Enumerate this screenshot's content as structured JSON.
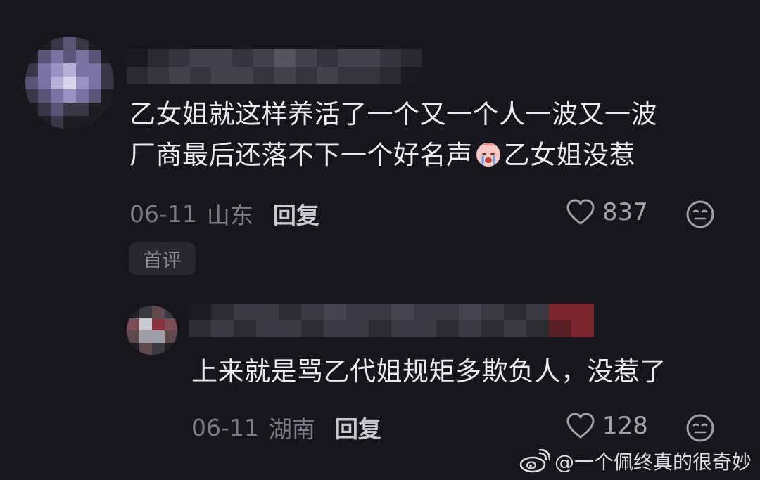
{
  "main_comment": {
    "text_line1": "乙女姐就这样养活了一个又一个人一波又一波",
    "text_line2_before": "厂商最后还落不下一个好名声",
    "text_line2_after": "乙女姐没惹",
    "emoji": "crying-face",
    "date": "06-11",
    "location": "山东",
    "reply_label": "回复",
    "likes": "837",
    "badge": "首评"
  },
  "reply_comment": {
    "text": "上来就是骂乙代姐规矩多欺负人，没惹了",
    "date": "06-11",
    "location": "湖南",
    "reply_label": "回复",
    "likes": "128"
  },
  "watermark": {
    "text": "@一个佩终真的很奇妙"
  },
  "colors": {
    "background": "#16161c",
    "text_primary": "#ececf0",
    "text_meta": "#7c7c86",
    "badge_bg": "#27272e"
  }
}
